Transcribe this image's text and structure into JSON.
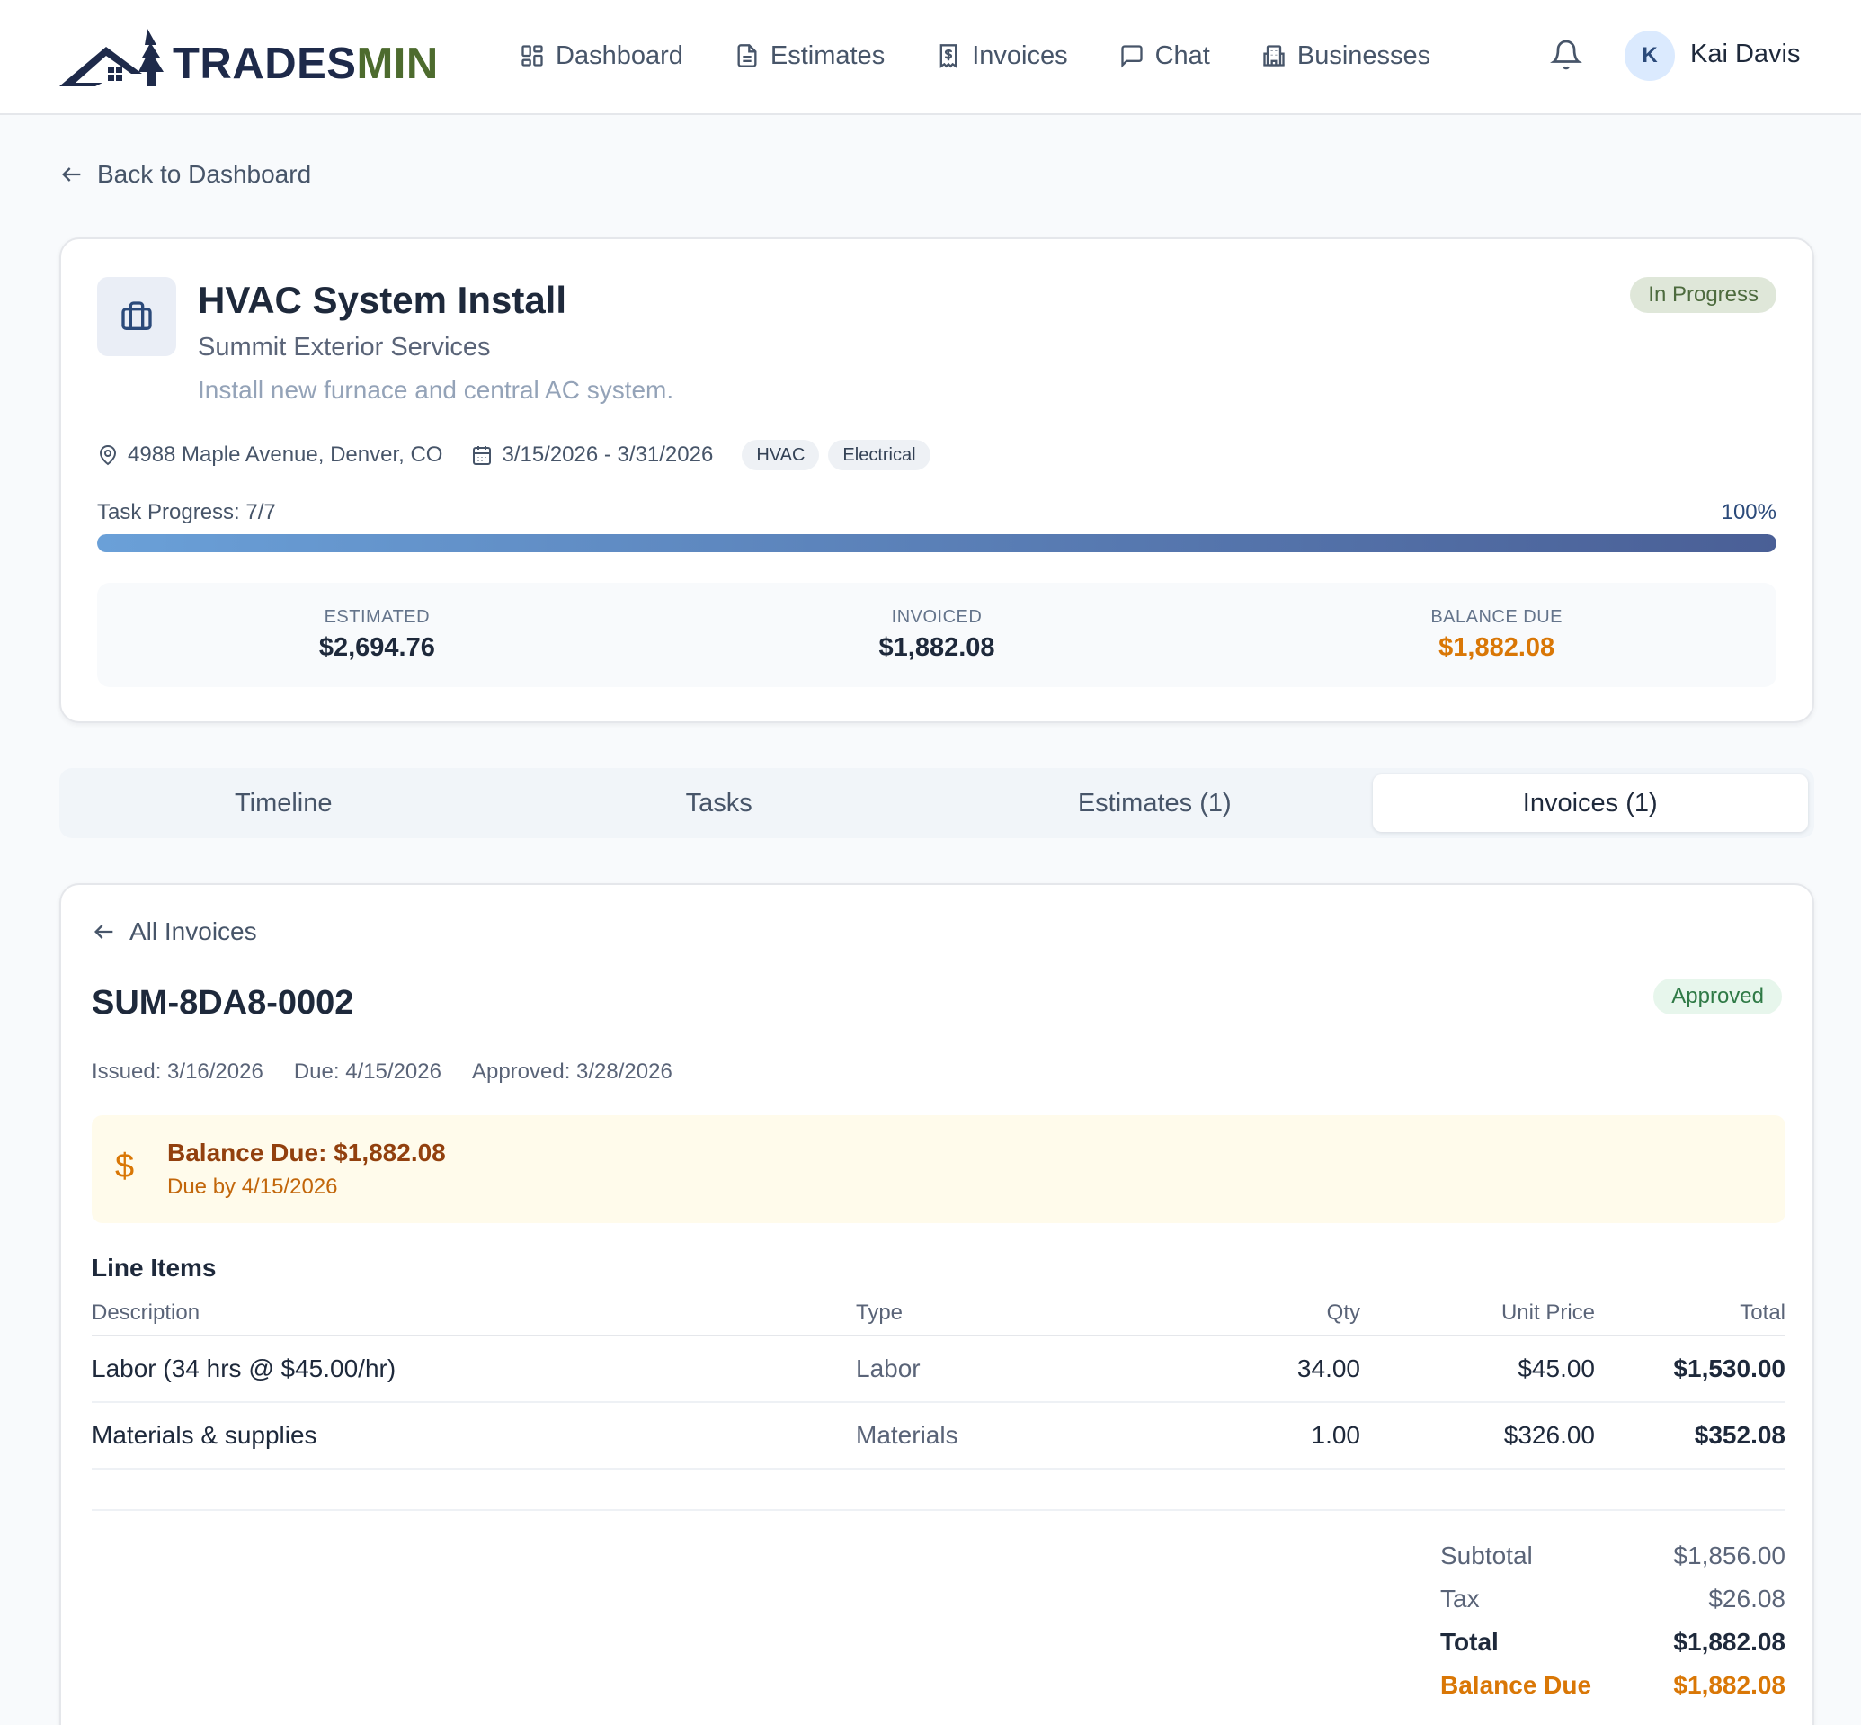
{
  "brand": {
    "name_part1": "TRADES",
    "name_part2": "MIN"
  },
  "nav": {
    "items": [
      {
        "label": "Dashboard",
        "icon": "dashboard-grid-icon"
      },
      {
        "label": "Estimates",
        "icon": "document-icon"
      },
      {
        "label": "Invoices",
        "icon": "receipt-dollar-icon"
      },
      {
        "label": "Chat",
        "icon": "chat-bubble-icon"
      },
      {
        "label": "Businesses",
        "icon": "building-icon"
      }
    ]
  },
  "user": {
    "initial": "K",
    "name": "Kai Davis"
  },
  "back_link": "Back to Dashboard",
  "job": {
    "title": "HVAC System Install",
    "company": "Summit Exterior Services",
    "description": "Install new furnace and central AC system.",
    "status": "In Progress",
    "address": "4988 Maple Avenue, Denver, CO",
    "date_range": "3/15/2026 - 3/31/2026",
    "tags": [
      "HVAC",
      "Electrical"
    ],
    "progress_label": "Task Progress: 7/7",
    "progress_percent_label": "100%",
    "progress_fraction": 1.0,
    "summary": {
      "estimated_label": "ESTIMATED",
      "estimated": "$2,694.76",
      "invoiced_label": "INVOICED",
      "invoiced": "$1,882.08",
      "balance_label": "BALANCE DUE",
      "balance": "$1,882.08"
    }
  },
  "tabs": [
    {
      "label": "Timeline",
      "active": false
    },
    {
      "label": "Tasks",
      "active": false
    },
    {
      "label": "Estimates (1)",
      "active": false
    },
    {
      "label": "Invoices (1)",
      "active": true
    }
  ],
  "invoice": {
    "back_label": "All Invoices",
    "number": "SUM-8DA8-0002",
    "status": "Approved",
    "issued": "Issued: 3/16/2026",
    "due": "Due: 4/15/2026",
    "approved": "Approved: 3/28/2026",
    "balance_banner": {
      "icon": "$",
      "title": "Balance Due: $1,882.08",
      "subtitle": "Due by 4/15/2026"
    },
    "line_items_title": "Line Items",
    "columns": {
      "description": "Description",
      "type": "Type",
      "qty": "Qty",
      "unit_price": "Unit Price",
      "total": "Total"
    },
    "items": [
      {
        "description": "Labor (34 hrs @ $45.00/hr)",
        "type": "Labor",
        "qty": "34.00",
        "unit_price": "$45.00",
        "total": "$1,530.00"
      },
      {
        "description": "Materials & supplies",
        "type": "Materials",
        "qty": "1.00",
        "unit_price": "$326.00",
        "total": "$352.08"
      }
    ],
    "totals": {
      "subtotal_label": "Subtotal",
      "subtotal": "$1,856.00",
      "tax_label": "Tax",
      "tax": "$26.08",
      "total_label": "Total",
      "total": "$1,882.08",
      "balance_label": "Balance Due",
      "balance": "$1,882.08"
    }
  },
  "colors": {
    "brand_navy": "#1e2a4a",
    "brand_green": "#4d6b2e",
    "accent_orange": "#d97706",
    "approved_green": "#2f7a46"
  }
}
